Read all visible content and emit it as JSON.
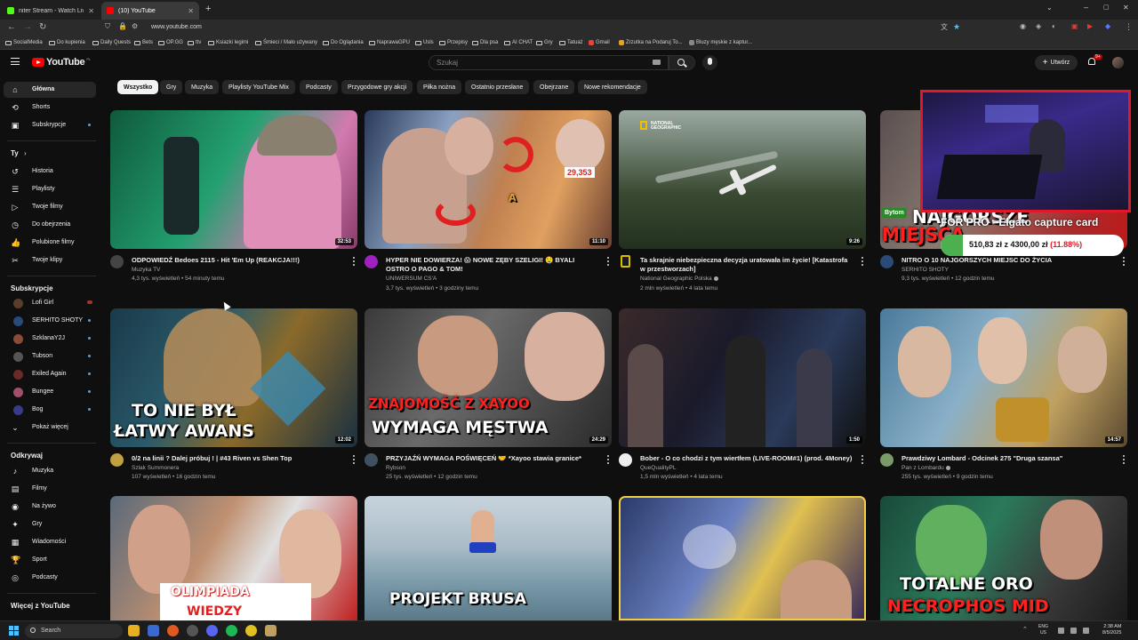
{
  "browser": {
    "tabs": [
      {
        "label": "niter Stream - Watch Live on Ki",
        "active": false
      },
      {
        "label": "(10) YouTube",
        "active": true
      }
    ],
    "new_tab": "+",
    "url": "www.youtube.com"
  },
  "bookmarks": [
    "SocialMedia",
    "Do kupienia",
    "Daily Quests",
    "Bets",
    "OP.GG",
    "ttv",
    "Ksiazki legimi",
    "Śmieci / Mało używany",
    "Do Oglądania",
    "NaprawaGPU",
    "Usls",
    "Przepisy",
    "Dla psa",
    "AI CHAT",
    "Gry",
    "Tatuaż",
    "Gmail",
    "Zrzutka na Podaruj To...",
    "Bluzy męskie z kaptur..."
  ],
  "header": {
    "logo": "YouTube",
    "logo_country": "PL",
    "search_placeholder": "Szukaj",
    "create_label": "Utwórz",
    "notifications_badge": "9+"
  },
  "sidebar": {
    "main": [
      {
        "label": "Główna",
        "icon": "home-icon",
        "glyph": "⌂",
        "active": true
      },
      {
        "label": "Shorts",
        "icon": "shorts-icon",
        "glyph": "⟲"
      },
      {
        "label": "Subskrypcje",
        "icon": "subscriptions-icon",
        "glyph": "▣",
        "dot": true
      }
    ],
    "you_header": "Ty",
    "you_chevron": "›",
    "you": [
      {
        "label": "Historia",
        "icon": "history-icon",
        "glyph": "↺"
      },
      {
        "label": "Playlisty",
        "icon": "playlists-icon",
        "glyph": "☰"
      },
      {
        "label": "Twoje filmy",
        "icon": "your-videos-icon",
        "glyph": "▷"
      },
      {
        "label": "Do obejrzenia",
        "icon": "watch-later-icon",
        "glyph": "◷"
      },
      {
        "label": "Polubione filmy",
        "icon": "liked-icon",
        "glyph": "👍"
      },
      {
        "label": "Twoje klipy",
        "icon": "clips-icon",
        "glyph": "✂"
      }
    ],
    "subs_header": "Subskrypcje",
    "subscriptions": [
      {
        "label": "Lofi Girl",
        "color": "#5a3d2b",
        "live": true
      },
      {
        "label": "SERHITO SHOTY",
        "color": "#2a4a7a",
        "dot": true
      },
      {
        "label": "SzklanaY2J",
        "color": "#8a4a3a",
        "dot": true
      },
      {
        "label": "Tubson",
        "color": "#555555",
        "dot": true
      },
      {
        "label": "Exiled Again",
        "color": "#6a2a2a",
        "dot": true
      },
      {
        "label": "Bungee",
        "color": "#a0506a",
        "dot": true
      },
      {
        "label": "Bog",
        "color": "#3a3a8a",
        "dot": true
      }
    ],
    "show_more": "Pokaż więcej",
    "explore_header": "Odkrywaj",
    "explore": [
      {
        "label": "Muzyka",
        "icon": "music-icon",
        "glyph": "♪"
      },
      {
        "label": "Filmy",
        "icon": "movies-icon",
        "glyph": "▤"
      },
      {
        "label": "Na żywo",
        "icon": "live-icon",
        "glyph": "◉"
      },
      {
        "label": "Gry",
        "icon": "gaming-icon",
        "glyph": "✦"
      },
      {
        "label": "Wiadomości",
        "icon": "news-icon",
        "glyph": "▦"
      },
      {
        "label": "Sport",
        "icon": "sport-icon",
        "glyph": "🏆"
      },
      {
        "label": "Podcasty",
        "icon": "podcasts-icon",
        "glyph": "◎"
      }
    ],
    "more_header": "Więcej z YouTube"
  },
  "chips": [
    "Wszystko",
    "Gry",
    "Muzyka",
    "Playlisty YouTube Mix",
    "Podcasty",
    "Przygodowe gry akcji",
    "Piłka nożna",
    "Ostatnio przesłane",
    "Obejrzane",
    "Nowe rekomendacje"
  ],
  "videos": [
    {
      "title": "ODPOWIEDŹ Bedoes 2115 - Hit 'Em Up (REAKCJA!!!)",
      "channel": "Muzyka TV",
      "meta": "4,3 tys. wyświetleń • 54 minuty temu",
      "duration": "32:53",
      "bg": "linear-gradient(120deg,#0f5a3c 0%,#23a070 45%,#d27ab0 75%,#8a3c6a 100%)",
      "av": "#444"
    },
    {
      "title": "HYPER NIE DOWIERZA! 😱 NOWE ZĘBY SZELIGI! 🤤 BYALI OSTRO O PAGO & TOM!",
      "channel": "UNIWERSUM CS'A",
      "meta": "3,7 tys. wyświetleń • 3 godziny temu",
      "duration": "11:10",
      "bg": "linear-gradient(110deg,#2a3a5a 0%,#8aa0c0 30%,#c08050 55%,#e0a060 75%,#6a4030 100%)",
      "av": "#a020c0"
    },
    {
      "title": "Ta skrajnie niebezpieczna decyzja uratowała im życie! [Katastrofa w przestworzach]",
      "channel": "National Geographic Polska",
      "meta": "2 mln wyświetleń • 4 lata temu",
      "duration": "9:26",
      "bg": "linear-gradient(180deg,#9aa8a0 0%,#6a7a6a 30%,#3a4a32 60%,#22301e 100%)",
      "av": "#d8c000",
      "verified": true
    },
    {
      "title": "NITRO O 10 NAJGORSZYCH MIEJSC DO ŻYCIA",
      "channel": "SERHITO SHOTY",
      "meta": "9,3 tys. wyświetleń • 12 godzin temu",
      "duration": "",
      "bg": "linear-gradient(120deg,#5a5050 0%,#8a7a70 40%,#aa2a2a 80%,#c01818 100%)",
      "av": "#2a4a7a"
    },
    {
      "title": "0/2 na linii ? Dalej próbuj ! | #43 Riven vs Shen Top",
      "channel": "Szlak Summonera",
      "meta": "107 wyświetleń • 16 godzin temu",
      "duration": "12:02",
      "bg": "linear-gradient(120deg,#1a3a4a 0%,#2a5a6a 35%,#8a6a2a 60%,#1a3040 100%)",
      "av": "#c0a040"
    },
    {
      "title": "PRZYJAŹŃ WYMAGA POŚWIĘCEŃ 🤝 *Xayoo stawia granice*",
      "channel": "Rybson",
      "meta": "25 tys. wyświetleń • 12 godzin temu",
      "duration": "24:29",
      "bg": "linear-gradient(120deg,#3a3a3a 0%,#6a6a6a 40%,#2a2a2a 100%)",
      "av": "#405060"
    },
    {
      "title": "Bober - O co chodzi z tym wiertłem (LIVE-ROOM#1) (prod. 4Money)",
      "channel": "QueQualityPL",
      "meta": "1,5 mln wyświetleń • 4 lata temu",
      "duration": "1:50",
      "bg": "linear-gradient(120deg,#3a2a2a 0%,#1a1a2a 40%,#2a3a5a 70%,#101010 100%)",
      "av": "#eeeeee"
    },
    {
      "title": "Prawdziwy Lombard - Odcinek 275 \"Druga szansa\"",
      "channel": "Pan z Lombardu",
      "meta": "255 tys. wyświetleń • 9 godzin temu",
      "duration": "14:57",
      "bg": "linear-gradient(120deg,#4a7a9a 0%,#8ab0c8 40%,#c0a060 70%,#5a4a30 100%)",
      "av": "#7a9a6a",
      "verified": true
    },
    {
      "title": "",
      "channel": "",
      "meta": "",
      "duration": "",
      "bg": "linear-gradient(120deg,#5a6a7a 0%,#c09070 40%,#e0e0e0 60%,#c02020 100%)",
      "av": "#555"
    },
    {
      "title": "",
      "channel": "",
      "meta": "",
      "duration": "",
      "bg": "linear-gradient(180deg,#c8d4dc 0%,#aabcc8 40%,#7a9aaa 70%,#5a7a8a 100%)",
      "av": "#555"
    },
    {
      "title": "",
      "channel": "",
      "meta": "",
      "duration": "",
      "bg": "linear-gradient(120deg,#2a3a6a 0%,#6a80c0 40%,#e0c050 60%,#3a2a5a 100%)",
      "av": "#555",
      "highlight": true
    },
    {
      "title": "",
      "channel": "",
      "meta": "",
      "duration": "",
      "bg": "linear-gradient(120deg,#1a4a3a 0%,#2a7a5a 40%,#3a3a3a 70%,#1a1a1a 100%)",
      "av": "#555"
    }
  ],
  "thumb_text": {
    "v5_line1": "TO NIE BYŁ",
    "v5_line2": "ŁATWY AWANS",
    "v6_line1": "ZNAJOMOŚĆ Z XAYOO",
    "v6_line2": "WYMAGA MĘSTWA",
    "v2_score": "29,353",
    "v2_letter": "A",
    "v3_brand": "NATIONAL GEOGRAPHIC",
    "v4_badge": "Bytom",
    "v4_text1": "NAJGORSZE",
    "v4_text2": "MIEJSCA",
    "v9_line1": "OLIMPIADA",
    "v9_line2": "WIEDZY",
    "v10_line1": "PROJEKT BRUSA",
    "v12_line1": "TOTALNE ORO",
    "v12_line2": "NECROPHOS MID"
  },
  "overlay": {
    "capture_text": "FOR PRO - Elgato capture card",
    "progress_text": "510,83 zł z 4300,00 zł",
    "progress_pct": "(11.88%)",
    "progress_fraction": 0.1188
  },
  "taskbar": {
    "search_label": "Search",
    "lang1": "ENG",
    "lang2": "US",
    "time": "2:38 AM",
    "date": "8/5/2025"
  }
}
